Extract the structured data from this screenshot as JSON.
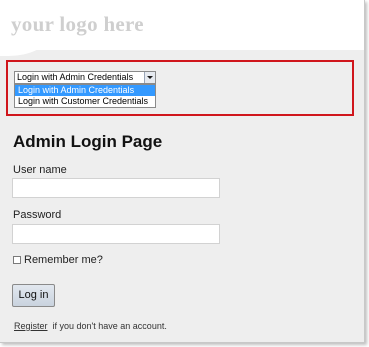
{
  "header": {
    "logo_text": "your logo here"
  },
  "credential_select": {
    "selected_label": "Login with Admin Credentials",
    "options": [
      {
        "label": "Login with Admin Credentials",
        "highlighted": true
      },
      {
        "label": "Login with Customer Credentials",
        "highlighted": false
      }
    ]
  },
  "form": {
    "title": "Admin Login Page",
    "username_label": "User name",
    "username_value": "",
    "password_label": "Password",
    "password_value": "",
    "remember_label": "Remember me?",
    "remember_checked": false,
    "submit_label": "Log in"
  },
  "footer": {
    "register_link": "Register",
    "register_suffix": "if you don't have an account."
  },
  "colors": {
    "highlight_border": "#d0161c",
    "selected_option": "#3399ff",
    "page_background": "#eeeeee"
  }
}
